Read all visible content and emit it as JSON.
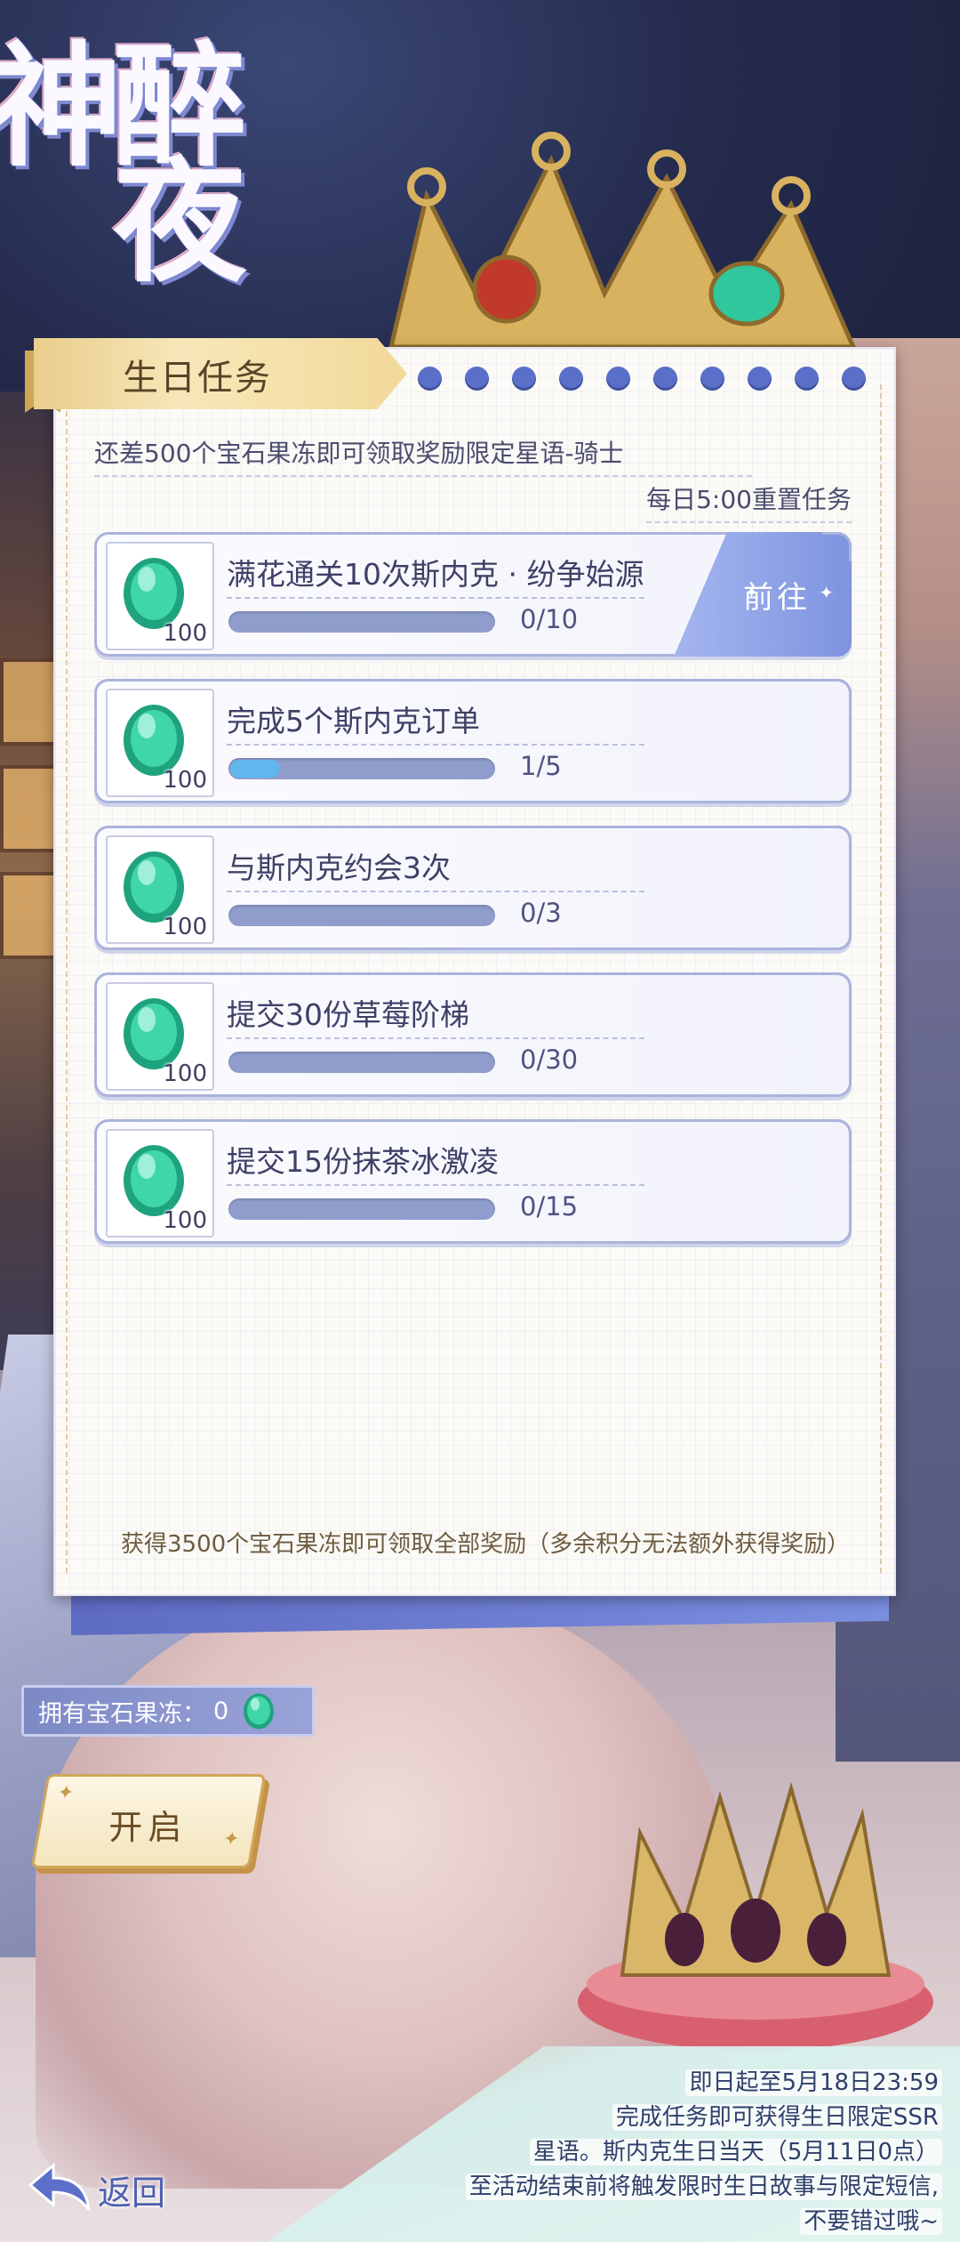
{
  "event": {
    "title": "醉夜神",
    "colors": {
      "accent": "#7e94e0",
      "panel": "#fbfaf6",
      "gem": "#2fc79b",
      "tab": "#f3dfa6"
    }
  },
  "panel": {
    "tab_label": "生日任务",
    "reward_description": "还差500个宝石果冻即可领取奖励限定星语-骑士",
    "reset_note": "每日5:00重置任务",
    "footer_note": "获得3500个宝石果冻即可领取全部奖励（多余积分无法额外获得奖励）"
  },
  "tasks": [
    {
      "title": "满花通关10次斯内克 · 纷争始源",
      "progress_text": "0/10",
      "progress": 0.0,
      "reward_count": "100",
      "action_label": "前往",
      "icon": "gem-icon"
    },
    {
      "title": "完成5个斯内克订单",
      "progress_text": "1/5",
      "progress": 0.2,
      "reward_count": "100",
      "icon": "gem-icon"
    },
    {
      "title": "与斯内克约会3次",
      "progress_text": "0/3",
      "progress": 0.0,
      "reward_count": "100",
      "icon": "gem-icon"
    },
    {
      "title": "提交30份草莓阶梯",
      "progress_text": "0/30",
      "progress": 0.0,
      "reward_count": "100",
      "icon": "gem-icon"
    },
    {
      "title": "提交15份抹茶冰激凌",
      "progress_text": "0/15",
      "progress": 0.0,
      "reward_count": "100",
      "icon": "gem-icon"
    }
  ],
  "wallet": {
    "label": "拥有宝石果冻：",
    "count": "0",
    "icon": "gem-icon"
  },
  "open_button": {
    "label": "开启"
  },
  "info_lines": [
    "即日起至5月18日23:59",
    "完成任务即可获得生日限定SSR",
    "星语。斯内克生日当天（5月11日0点）",
    "至活动结束前将触发限时生日故事与限定短信,",
    "不要错过哦~"
  ],
  "back_button": {
    "label": "返回",
    "icon": "back-arrow-icon"
  }
}
